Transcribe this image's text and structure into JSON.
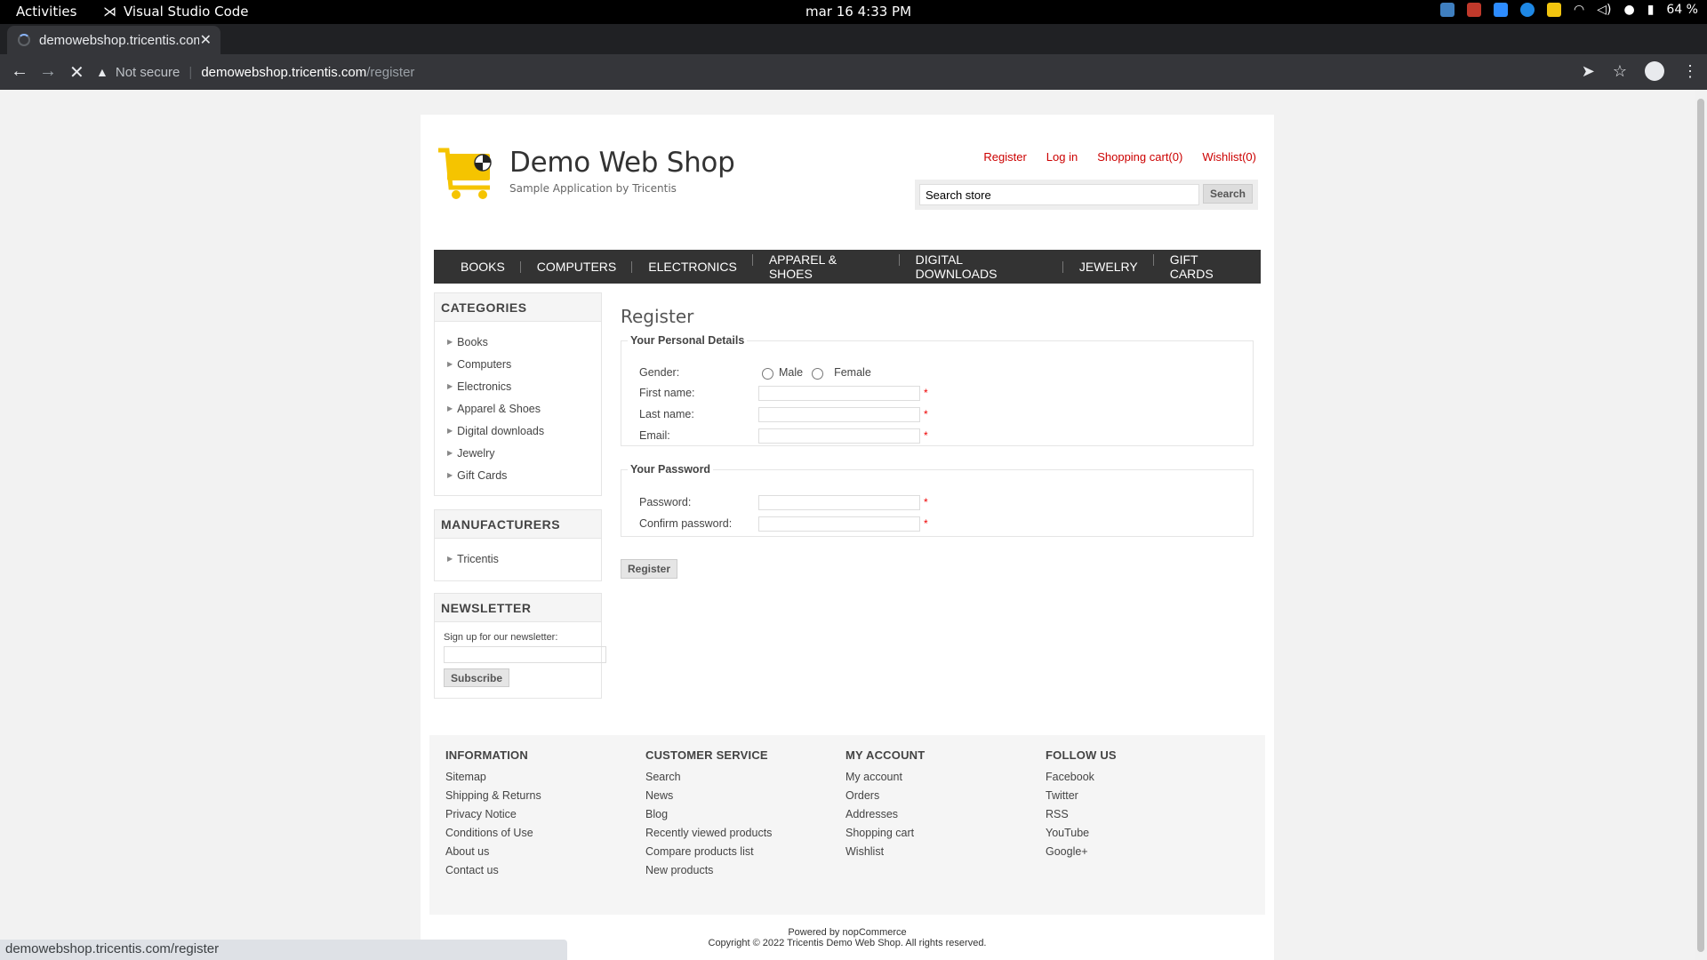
{
  "os": {
    "activities": "Activities",
    "app_name": "Visual Studio Code",
    "clock": "mar 16  4:33 PM",
    "battery": "64 %"
  },
  "browser": {
    "tab_title": "demowebshop.tricentis.com/register",
    "security": "Not secure",
    "url_host": "demowebshop.tricentis.com",
    "url_path": "/register",
    "status_url": "demowebshop.tricentis.com/register"
  },
  "site": {
    "name": "Demo Web Shop",
    "tagline": "Sample Application by Tricentis",
    "header_links": [
      "Register",
      "Log in",
      "Shopping cart(0)",
      "Wishlist(0)"
    ],
    "search_value": "Search store",
    "search_button": "Search",
    "menu": [
      "BOOKS",
      "COMPUTERS",
      "ELECTRONICS",
      "APPAREL & SHOES",
      "DIGITAL DOWNLOADS",
      "JEWELRY",
      "GIFT CARDS"
    ],
    "brand_color": "#cc0000"
  },
  "sidebar": {
    "categories_title": "CATEGORIES",
    "categories": [
      "Books",
      "Computers",
      "Electronics",
      "Apparel & Shoes",
      "Digital downloads",
      "Jewelry",
      "Gift Cards"
    ],
    "manufacturers_title": "MANUFACTURERS",
    "manufacturers": [
      "Tricentis"
    ],
    "newsletter_title": "NEWSLETTER",
    "newsletter_label": "Sign up for our newsletter:",
    "subscribe": "Subscribe"
  },
  "form": {
    "title": "Register",
    "personal_legend": "Your Personal Details",
    "gender_label": "Gender:",
    "male": "Male",
    "female": "Female",
    "first_name": "First name:",
    "last_name": "Last name:",
    "email": "Email:",
    "password_legend": "Your Password",
    "password": "Password:",
    "confirm_password": "Confirm password:",
    "required_mark": "*",
    "submit": "Register"
  },
  "footer": {
    "columns": [
      {
        "title": "INFORMATION",
        "links": [
          "Sitemap",
          "Shipping & Returns",
          "Privacy Notice",
          "Conditions of Use",
          "About us",
          "Contact us"
        ]
      },
      {
        "title": "CUSTOMER SERVICE",
        "links": [
          "Search",
          "News",
          "Blog",
          "Recently viewed products",
          "Compare products list",
          "New products"
        ]
      },
      {
        "title": "MY ACCOUNT",
        "links": [
          "My account",
          "Orders",
          "Addresses",
          "Shopping cart",
          "Wishlist"
        ]
      },
      {
        "title": "FOLLOW US",
        "links": [
          "Facebook",
          "Twitter",
          "RSS",
          "YouTube",
          "Google+"
        ]
      }
    ],
    "powered": "Powered by nopCommerce",
    "copyright": "Copyright © 2022 Tricentis Demo Web Shop. All rights reserved."
  }
}
